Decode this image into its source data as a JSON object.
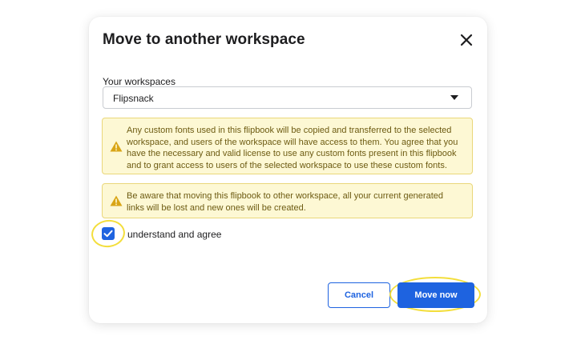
{
  "dialog": {
    "title": "Move to another workspace",
    "close_icon": "close-icon"
  },
  "workspaces": {
    "label": "Your workspaces",
    "selected": "Flipsnack",
    "caret_icon": "caret-down-icon"
  },
  "warnings": [
    {
      "icon": "warning-icon",
      "text": "Any custom fonts used in this flipbook will be copied and transferred to the selected workspace, and users of the workspace will have access to them. You agree that you have the necessary and valid license to use any custom fonts present in this flipbook and to grant access to users of the selected workspace to use these custom fonts."
    },
    {
      "icon": "warning-icon",
      "text": "Be aware that moving this flipbook to other workspace, all your current generated links will be lost and new ones will be created."
    }
  ],
  "agreement": {
    "checked": true,
    "label": "understand and agree"
  },
  "actions": {
    "cancel_label": "Cancel",
    "confirm_label": "Move now"
  },
  "colors": {
    "accent": "#1e63e0",
    "warning_bg": "#fdf8d4",
    "warning_border": "#ead77a",
    "warning_text": "#6d5b12",
    "highlight": "#f3de3c"
  }
}
